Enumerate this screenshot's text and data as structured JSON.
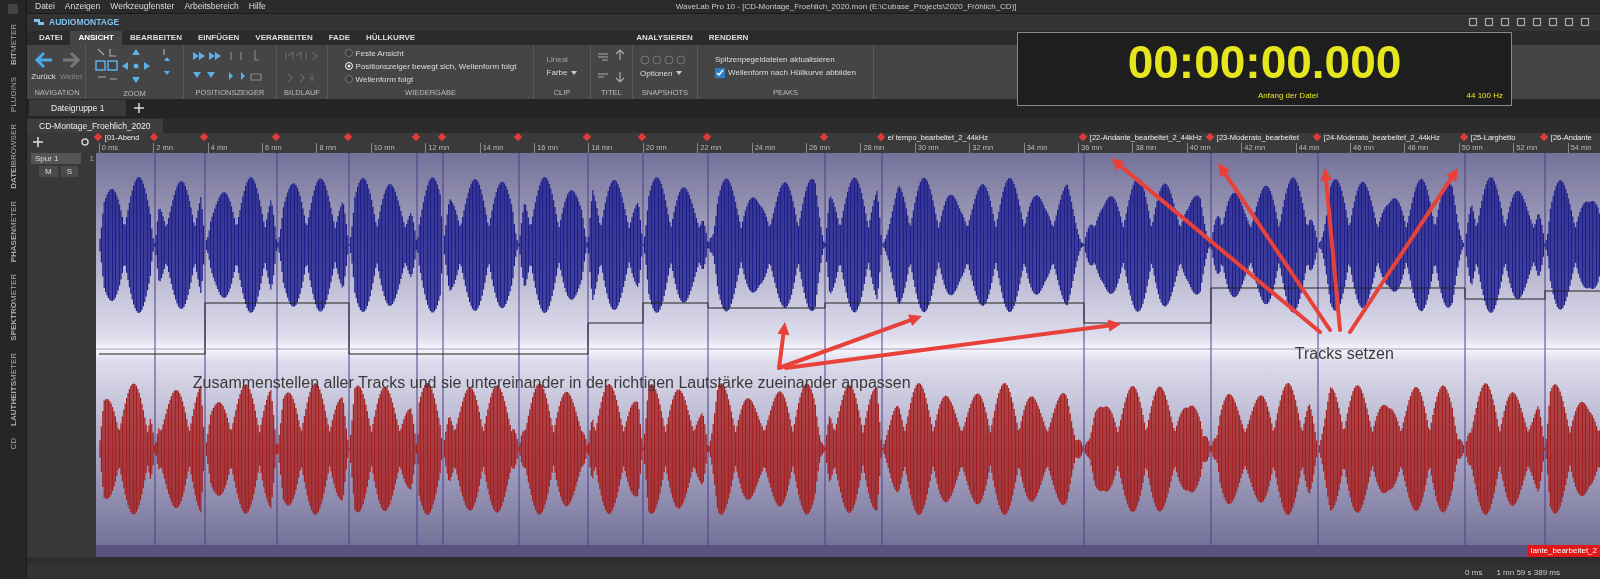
{
  "window": {
    "title": "WaveLab Pro 10 - [CD-Montage_Froehlich_2020.mon (E:\\Cubase_Projects\\2020_Fröhlich_CD)]"
  },
  "menu": [
    "Datei",
    "Anzeigen",
    "Werkzeugfenster",
    "Arbeitsbereich",
    "Hilfe"
  ],
  "side_panels": [
    {
      "label": "**BIT**METER"
    },
    {
      "label": "PLUGINS"
    },
    {
      "label": "**DATEI**BROWSER"
    },
    {
      "label": "**PHASEN**METER"
    },
    {
      "label": "**SPEKTRO**METER"
    },
    {
      "label": "**LAUTHEITS**METER"
    },
    {
      "label": "CD"
    }
  ],
  "workspace": {
    "title": "AUDIOMONTAGE"
  },
  "tabs": [
    {
      "label": "DATEI",
      "selected": false
    },
    {
      "label": "ANSICHT",
      "selected": true
    },
    {
      "label": "BEARBEITEN",
      "selected": false
    },
    {
      "label": "EINFÜGEN",
      "selected": false
    },
    {
      "label": "VERARBEITEN",
      "selected": false
    },
    {
      "label": "FADE",
      "selected": false
    },
    {
      "label": "HÜLLKURVE",
      "selected": false
    }
  ],
  "tabs_right": [
    {
      "label": "ANALYSIEREN",
      "selected": false
    },
    {
      "label": "RENDERN",
      "selected": false
    }
  ],
  "ribbon": {
    "group_labels": [
      "NAVIGATION",
      "ZOOM",
      "POSITIONSZEIGER",
      "BILDLAUF",
      "WIEDERGABE",
      "CLIP",
      "TITEL",
      "SNAPSHOTS",
      "PEAKS"
    ],
    "navigation": [
      {
        "label": "Zurück",
        "disabled": false
      },
      {
        "label": "Weiter",
        "disabled": true
      }
    ],
    "playback": [
      {
        "label": "Feste Ansicht",
        "selected": false
      },
      {
        "label": "Positionszeiger bewegt sich, Wellenform folgt",
        "selected": true
      },
      {
        "label": "Wellenform folgt",
        "selected": false
      }
    ],
    "clip": {
      "ruler": {
        "label": "Lineal",
        "disabled": true
      },
      "color": {
        "label": "Farbe"
      }
    },
    "snapshots": {
      "options": "Optionen"
    },
    "peaks": {
      "update": "Spitzenpegeldateien aktualisieren",
      "checkbox": {
        "label": "Wellenform nach Hüllkurve abbilden",
        "checked": true
      }
    }
  },
  "timer": {
    "time": "00:00:00.000",
    "position": "Anfang der Datei",
    "rate": "44 100 Hz"
  },
  "file_group_tab": {
    "label": "Dateigruppe 1"
  },
  "montage_tab": {
    "label": "CD-Montage_Froehlich_2020"
  },
  "track": {
    "name": "Spur 1",
    "number": "1",
    "mute": "M",
    "solo": "S"
  },
  "ruler": {
    "ticks": [
      "0 ms",
      "2 mn",
      "4 mn",
      "6 mn",
      "8 mn",
      "10 mn",
      "12 mn",
      "14 mn",
      "16 mn",
      "18 mn",
      "20 mn",
      "22 mn",
      "24 mn",
      "26 mn",
      "28 mn",
      "30 mn",
      "32 mn",
      "34 mn",
      "36 mn",
      "38 mn",
      "40 mn",
      "42 mn",
      "44 mn",
      "46 mn",
      "48 mn",
      "50 mn",
      "52 mn",
      "54 mn"
    ]
  },
  "clip_markers": [
    {
      "label": "[01-Abend"
    },
    {
      "label": "el tempo_bearbeitet_2_44kHz"
    },
    {
      "label": "[22-Andante_bearbeitet_2_44kHz"
    },
    {
      "label": "[23-Moderato_bearbeitet"
    },
    {
      "label": "[24-Moderato_bearbeitet_2_44kHz"
    },
    {
      "label": "[25-Larghetto"
    },
    {
      "label": "[26-Andante"
    }
  ],
  "annotations": [
    {
      "text": "Zusammenstellen aller Tracks und sie untereinander in der richtigen Lautstärke zueinander anpassen"
    },
    {
      "text": "Tracks setzen"
    }
  ],
  "last_clip_label": "lante_bearbeitet_2",
  "status": {
    "start": "0 ms",
    "length": "1 mn 59 s 389 ms"
  }
}
